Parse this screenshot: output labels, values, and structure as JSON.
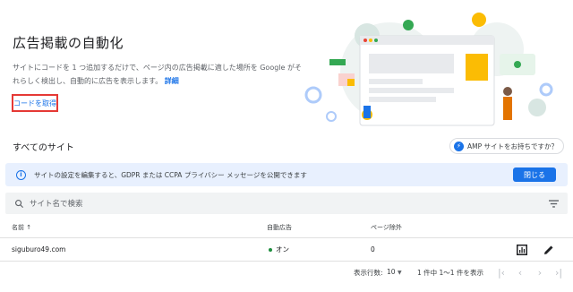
{
  "header": {
    "title": "広告掲載の自動化",
    "description": "サイトにコードを 1 つ追加するだけで、ページ内の広告掲載に適した場所を Google がそれらしく検出し、自動的に広告を表示します。",
    "details_link": "詳細",
    "get_code_button": "コードを取得"
  },
  "sites": {
    "section_title": "すべてのサイト",
    "amp_button": "AMP サイトをお持ちですか？"
  },
  "banner": {
    "text": "サイトの設定を編集すると、GDPR または CCPA プライバシー メッセージを公開できます",
    "close_button": "閉じる"
  },
  "search": {
    "placeholder": "サイト名で検索"
  },
  "table": {
    "columns": [
      "名前 ↑",
      "自動広告",
      "ページ除外"
    ],
    "rows": [
      {
        "name": "siguburo49.com",
        "auto_ads": "オン",
        "page_exclusions": "0"
      }
    ]
  },
  "pagination": {
    "rows_per_page_label": "表示行数:",
    "rows_per_page_value": "10",
    "range_text": "1 件中 1〜1 件を表示"
  },
  "colors": {
    "accent": "#1a73e8",
    "highlight_border": "#e53935",
    "banner_bg": "#e8f0fe",
    "status_on": "#1e8e3e"
  }
}
